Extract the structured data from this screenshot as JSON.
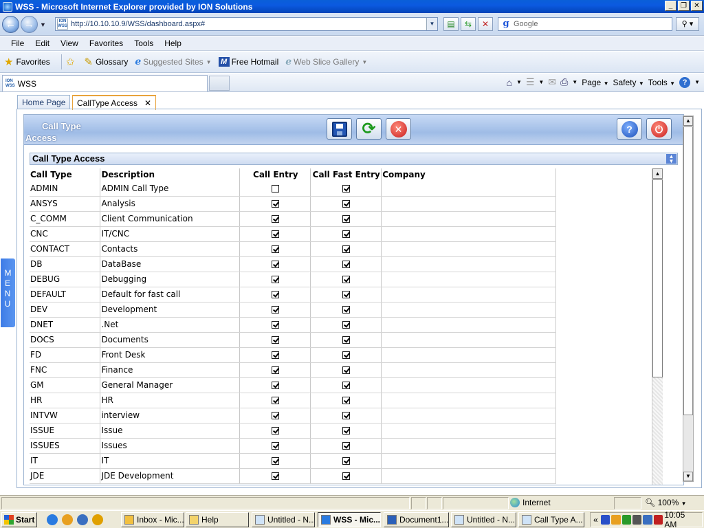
{
  "window": {
    "title": "WSS - Microsoft Internet Explorer provided by ION Solutions"
  },
  "address": {
    "url": "http://10.10.10.9/WSS/dashboard.aspx#",
    "search_placeholder": "Google"
  },
  "menus": [
    "File",
    "Edit",
    "View",
    "Favorites",
    "Tools",
    "Help"
  ],
  "favorites_bar": {
    "favorites": "Favorites",
    "glossary": "Glossary",
    "suggested": "Suggested Sites",
    "hotmail": "Free Hotmail",
    "webslice": "Web Slice Gallery"
  },
  "browser_tab": {
    "label": "WSS"
  },
  "commands": {
    "page": "Page",
    "safety": "Safety",
    "tools": "Tools"
  },
  "app_tabs": {
    "home": "Home Page",
    "active": "CallType Access"
  },
  "side_menu": {
    "label": "M E N U"
  },
  "panel": {
    "title_line1": "Call Type",
    "title_line2": "Access",
    "section_title": "Call Type Access"
  },
  "grid": {
    "headers": {
      "call_type": "Call Type",
      "description": "Description",
      "call_entry": "Call Entry",
      "call_fast_entry": "Call Fast Entry",
      "company": "Company"
    },
    "rows": [
      {
        "type": "ADMIN",
        "desc": "ADMIN Call Type",
        "entry": false,
        "fast": true,
        "company": ""
      },
      {
        "type": "ANSYS",
        "desc": "Analysis",
        "entry": true,
        "fast": true,
        "company": ""
      },
      {
        "type": "C_COMM",
        "desc": "Client Communication",
        "entry": true,
        "fast": true,
        "company": ""
      },
      {
        "type": "CNC",
        "desc": "IT/CNC",
        "entry": true,
        "fast": true,
        "company": ""
      },
      {
        "type": "CONTACT",
        "desc": "Contacts",
        "entry": true,
        "fast": true,
        "company": ""
      },
      {
        "type": "DB",
        "desc": "DataBase",
        "entry": true,
        "fast": true,
        "company": ""
      },
      {
        "type": "DEBUG",
        "desc": "Debugging",
        "entry": true,
        "fast": true,
        "company": ""
      },
      {
        "type": "DEFAULT",
        "desc": "Default for fast call",
        "entry": true,
        "fast": true,
        "company": ""
      },
      {
        "type": "DEV",
        "desc": "Development",
        "entry": true,
        "fast": true,
        "company": ""
      },
      {
        "type": "DNET",
        "desc": ".Net",
        "entry": true,
        "fast": true,
        "company": ""
      },
      {
        "type": "DOCS",
        "desc": "Documents",
        "entry": true,
        "fast": true,
        "company": ""
      },
      {
        "type": "FD",
        "desc": "Front Desk",
        "entry": true,
        "fast": true,
        "company": ""
      },
      {
        "type": "FNC",
        "desc": "Finance",
        "entry": true,
        "fast": true,
        "company": ""
      },
      {
        "type": "GM",
        "desc": "General Manager",
        "entry": true,
        "fast": true,
        "company": ""
      },
      {
        "type": "HR",
        "desc": "HR",
        "entry": true,
        "fast": true,
        "company": ""
      },
      {
        "type": "INTVW",
        "desc": "interview",
        "entry": true,
        "fast": true,
        "company": ""
      },
      {
        "type": "ISSUE",
        "desc": "Issue",
        "entry": true,
        "fast": true,
        "company": ""
      },
      {
        "type": "ISSUES",
        "desc": "Issues",
        "entry": true,
        "fast": true,
        "company": ""
      },
      {
        "type": "IT",
        "desc": "IT",
        "entry": true,
        "fast": true,
        "company": ""
      },
      {
        "type": "JDE",
        "desc": "JDE Development",
        "entry": true,
        "fast": true,
        "company": ""
      }
    ]
  },
  "status": {
    "zone": "Internet",
    "zoom": "100%"
  },
  "taskbar": {
    "start": "Start",
    "tasks": [
      "Inbox - Mic...",
      "Help",
      "Untitled - N...",
      "WSS - Mic...",
      "Document1...",
      "Untitled - N...",
      "Call Type A..."
    ],
    "clock": "10:05 AM"
  },
  "colors": {
    "titlebar": "#0a5fd8",
    "panel_header": "#9fbce6",
    "active_tab_accent": "#e8a33c",
    "menu_tab": "#3d7be6"
  }
}
